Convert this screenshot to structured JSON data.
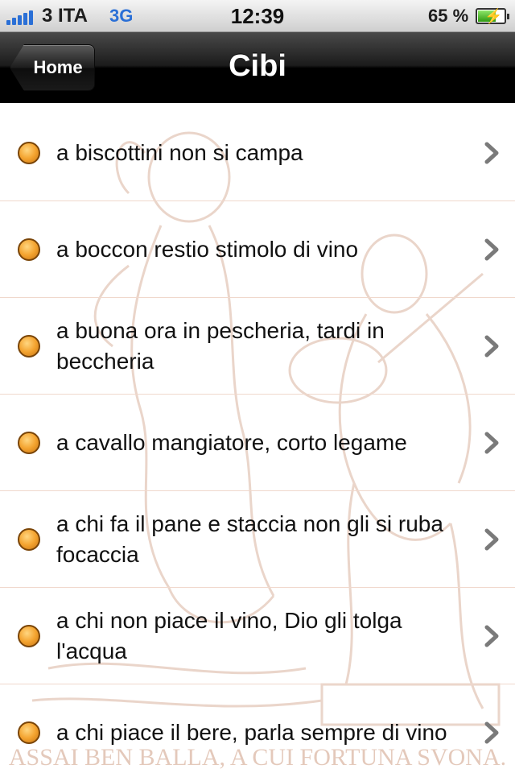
{
  "status_bar": {
    "carrier": "3 ITA",
    "network": "3G",
    "time": "12:39",
    "battery_percent_label": "65 %",
    "battery_level": 0.65
  },
  "nav": {
    "back_label": "Home",
    "title": "Cibi"
  },
  "list": {
    "items": [
      {
        "text": "a biscottini non si campa"
      },
      {
        "text": "a boccon restio stimolo di vino"
      },
      {
        "text": "a buona ora in pescheria, tardi in beccheria"
      },
      {
        "text": "a cavallo mangiatore, corto legame"
      },
      {
        "text": "a chi fa il pane e staccia non gli si ruba focaccia"
      },
      {
        "text": "a chi non piace il vino, Dio gli tolga l'acqua"
      },
      {
        "text": "a chi piace il bere, parla sempre di vino"
      }
    ]
  },
  "background": {
    "caption": "ASSAI BEN BALLA, A CUI FORTUNA SVONA.",
    "tint": "#c48a6a"
  },
  "colors": {
    "accent_blue": "#2a6fd6",
    "bullet": "#f4a430",
    "row_divider": "#f0d8cc"
  }
}
